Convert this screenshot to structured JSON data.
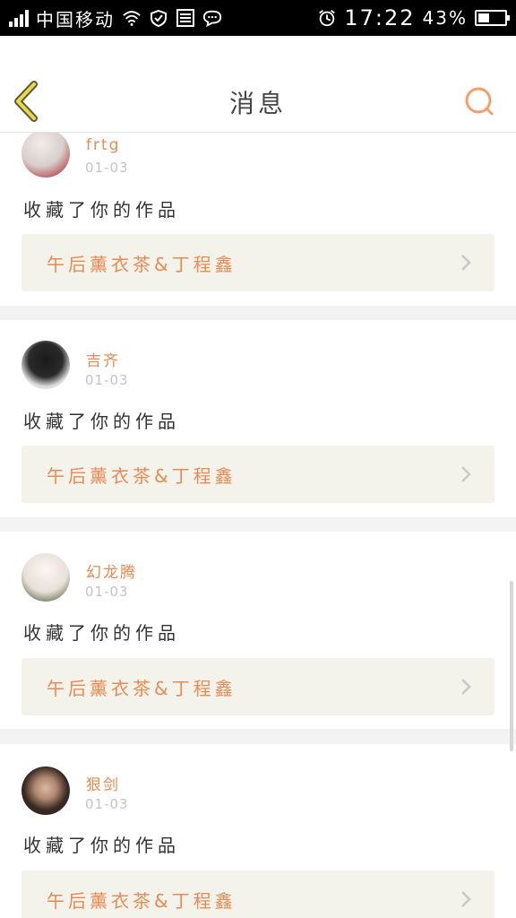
{
  "status_bar": {
    "carrier": "中国移动",
    "time": "17:22",
    "battery": "43%",
    "battery_level": 0.43,
    "icons": [
      "signal-icon",
      "wifi-icon",
      "shield-icon",
      "sim-icon",
      "chat-icon",
      "alarm-icon",
      "battery-icon"
    ]
  },
  "header": {
    "title": "消息",
    "back_icon": "chevron-left-icon",
    "search_icon": "search-icon"
  },
  "accent_color": "#e98a52",
  "messages": [
    {
      "user": "frtg",
      "date": "01-03",
      "action": "收藏了你的作品",
      "work": "午后薰衣茶&丁程鑫"
    },
    {
      "user": "吉齐",
      "date": "01-03",
      "action": "收藏了你的作品",
      "work": "午后薰衣茶&丁程鑫"
    },
    {
      "user": "幻龙腾",
      "date": "01-03",
      "action": "收藏了你的作品",
      "work": "午后薰衣茶&丁程鑫"
    },
    {
      "user": "狠剑",
      "date": "01-03",
      "action": "收藏了你的作品",
      "work": "午后薰衣茶&丁程鑫"
    }
  ]
}
